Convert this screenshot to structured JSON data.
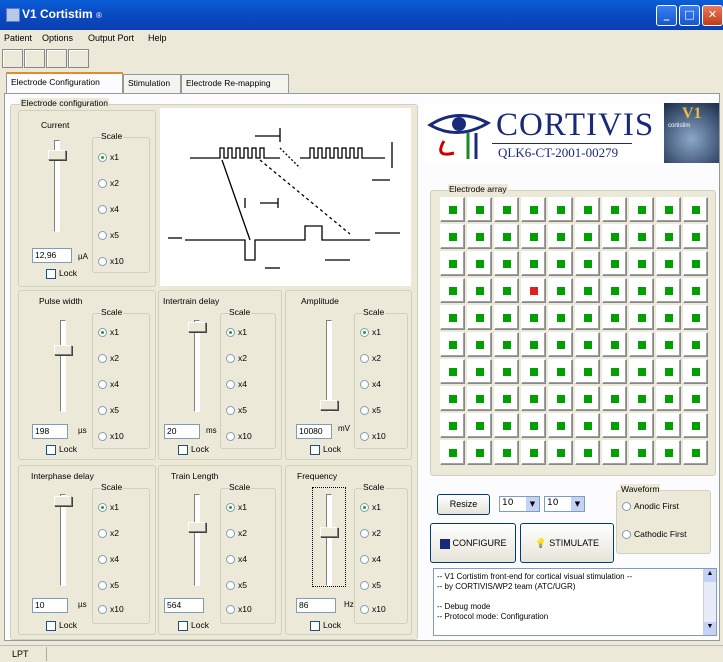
{
  "window": {
    "title": "V1 Cortistim",
    "title_suffix": "®"
  },
  "menu": [
    "Patient",
    "Options",
    "Output Port",
    "Help"
  ],
  "tabs": [
    "Electrode Configuration",
    "Stimulation",
    "Electrode Re-mapping"
  ],
  "config": {
    "legend": "Electrode configuration",
    "scale_label": "Scale",
    "scale_options": [
      "x1",
      "x2",
      "x4",
      "x5",
      "x10"
    ],
    "lock_label": "Lock"
  },
  "current": {
    "title": "Current",
    "value": "12,96",
    "unit": "µA"
  },
  "pulse_width": {
    "title": "Pulse width",
    "value": "198",
    "unit": "µs"
  },
  "intertrain_delay": {
    "title": "Intertrain delay",
    "value": "20",
    "unit": "ms"
  },
  "amplitude": {
    "title": "Amplitude",
    "value": "10080",
    "unit": "mV"
  },
  "interphase_delay": {
    "title": "Interphase delay",
    "value": "10",
    "unit": "µs"
  },
  "train_length": {
    "title": "Train Length",
    "value": "564",
    "unit": ""
  },
  "frequency": {
    "title": "Frequency",
    "value": "86",
    "unit": "Hz"
  },
  "logo": {
    "name": "CORTIVIS",
    "code": "QLK6-CT-2001-00279",
    "badge": "V1",
    "badge_sub": "cortistim"
  },
  "electrode_array": {
    "legend": "Electrode array",
    "rows": 10,
    "cols": 10,
    "active_cell": {
      "row": 3,
      "col": 3
    },
    "colors": {
      "on": "#00a000",
      "active": "#e02020"
    }
  },
  "controls": {
    "resize": "Resize",
    "rows_value": "10",
    "cols_value": "10",
    "configure": "CONFIGURE",
    "stimulate": "STIMULATE"
  },
  "waveform": {
    "legend": "Waveform",
    "options": [
      "Anodic First",
      "Cathodic First"
    ]
  },
  "log_lines": [
    "-- V1 Cortistim front-end for cortical visual stimulation --",
    "-- by CORTIVIS/WP2 team (ATC/UGR)",
    "",
    "-- Debug mode",
    "-- Protocol mode: Configuration"
  ],
  "status": {
    "port": "LPT"
  }
}
